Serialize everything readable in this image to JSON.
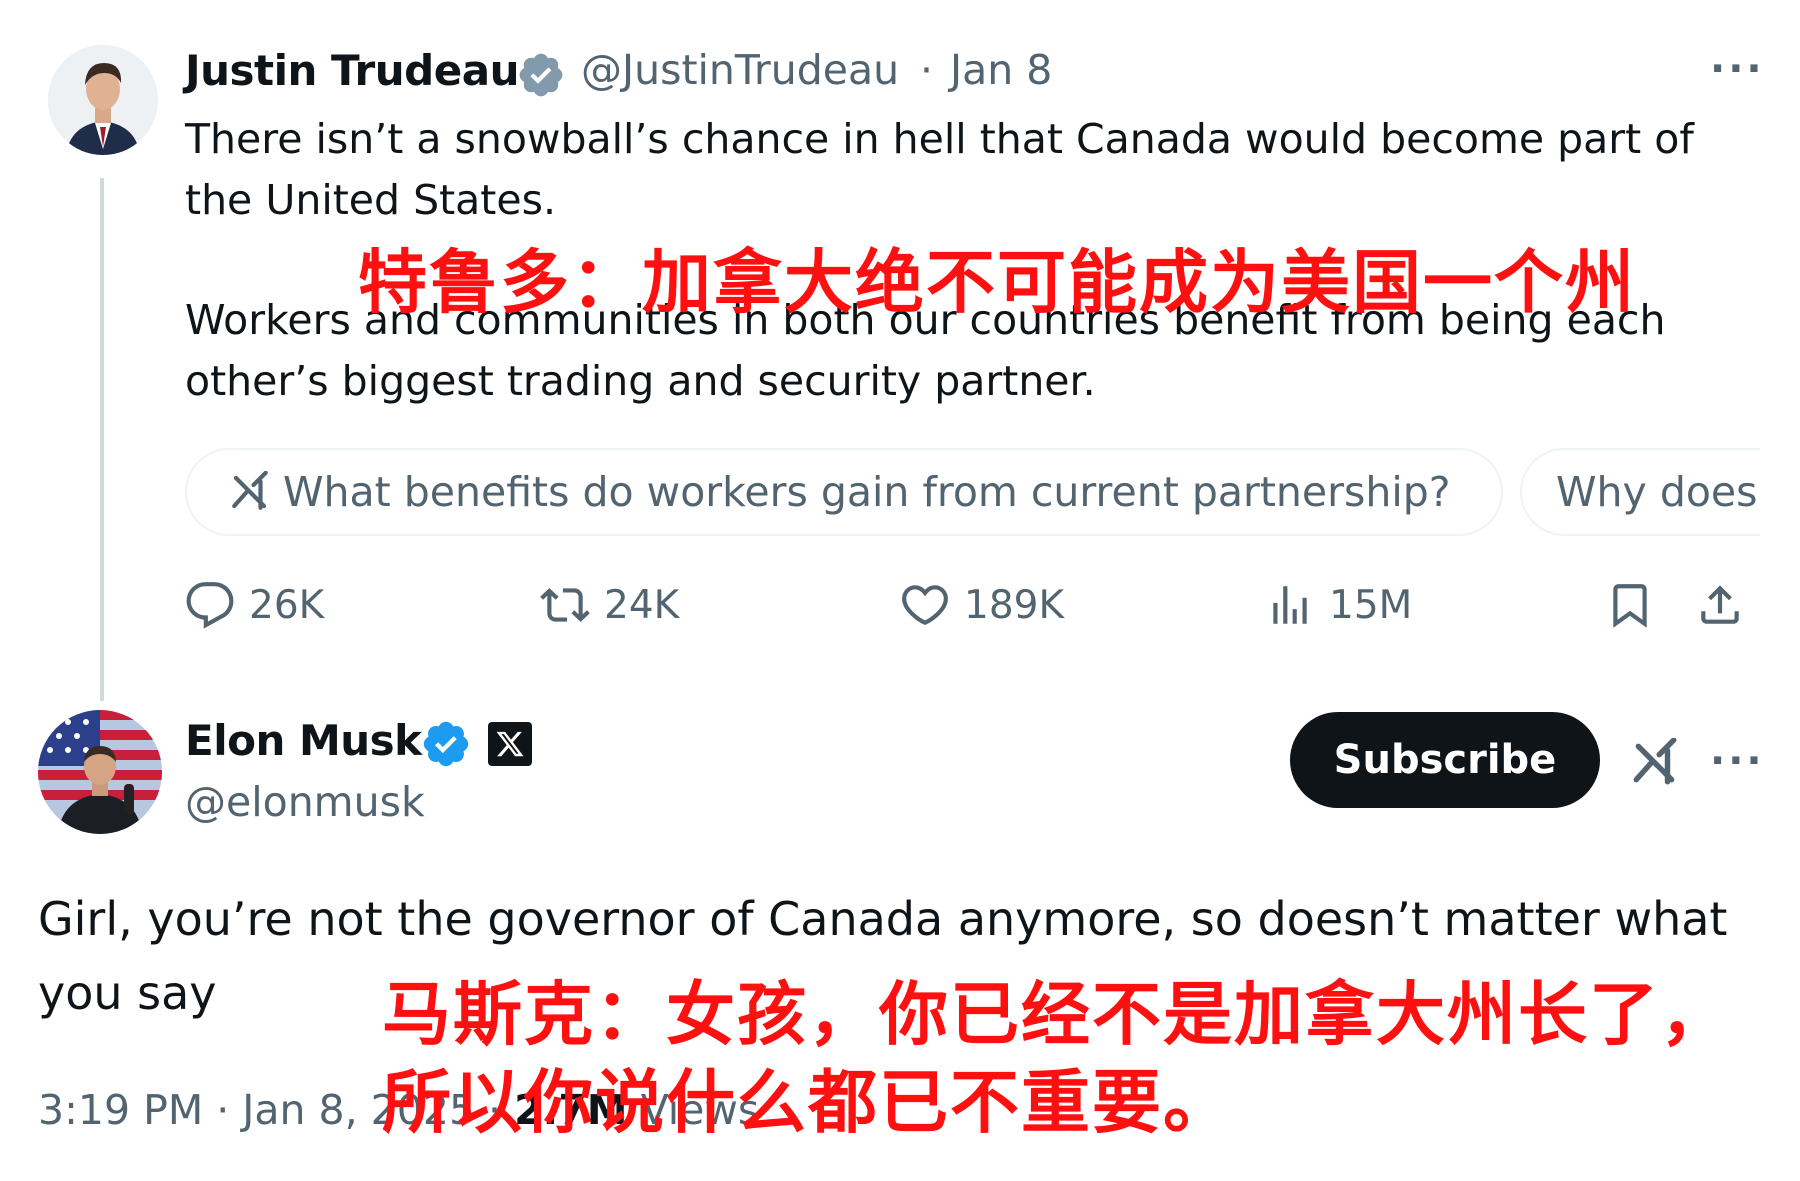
{
  "original_tweet": {
    "author_name": "Justin Trudeau",
    "author_handle": "@JustinTrudeau",
    "date": "Jan 8",
    "separator": "·",
    "text_line1": "There isn’t a snowball’s chance in hell that Canada would become part of",
    "text_line2": "the United States.",
    "text_line3": "Workers and communities in both our countries benefit from being each",
    "text_line4": "other’s biggest trading and security partner.",
    "grok_prompt_1": "What benefits do workers gain from current partnership?",
    "grok_prompt_2": "Why does",
    "metrics": {
      "replies": "26K",
      "reposts": "24K",
      "likes": "189K",
      "views": "15M"
    },
    "overlay_caption": "特鲁多：加拿大绝不可能成为美国一个州"
  },
  "reply_tweet": {
    "author_name": "Elon Musk",
    "author_handle": "@elonmusk",
    "subscribe_label": "Subscribe",
    "text_line1": "Girl, you’re not the governor of Canada anymore, so doesn’t matter what",
    "text_line2": "you say",
    "timestamp": "3:19 PM · Jan 8, 2025 ·",
    "view_count": "2.7M",
    "views_label": "Views",
    "overlay_caption_line1": "马斯克：女孩，你已经不是加拿大州长了，",
    "overlay_caption_line2": "所以你说什么都已不重要。"
  },
  "icons": {
    "more": "more-icon",
    "verified": "verified-badge-icon",
    "grok": "grok-icon",
    "reply": "reply-icon",
    "repost": "repost-icon",
    "like": "like-icon",
    "views": "views-icon",
    "bookmark": "bookmark-icon",
    "share": "share-icon",
    "x_affiliate": "x-logo-icon"
  },
  "colors": {
    "verified_blue": "#1d9bf0",
    "verified_gray": "#829aab",
    "secondary_text": "#536471",
    "overlay_red": "#ff1010",
    "subscribe_bg": "#0f1419"
  }
}
